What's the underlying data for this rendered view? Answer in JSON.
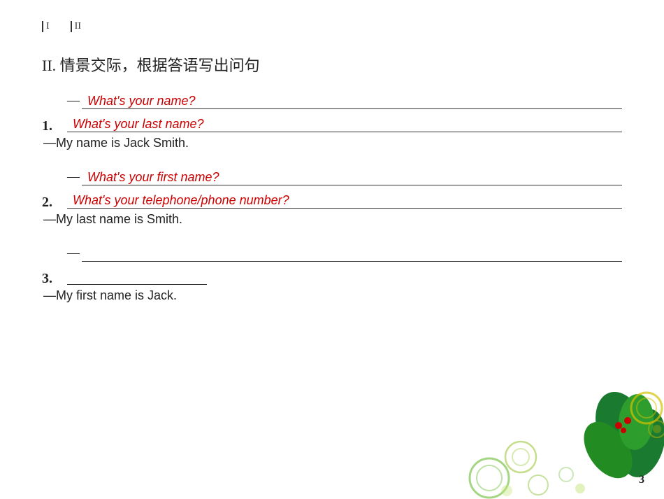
{
  "page": {
    "number": "3",
    "top_markers": [
      "I",
      "II"
    ],
    "section_title": "II. 情景交际，根据答语写出问句",
    "questions": [
      {
        "number": "1.",
        "lines": [
          {
            "prefix": "",
            "answer": "What's your name?"
          },
          {
            "prefix": "",
            "answer": "What's your last name?"
          }
        ],
        "static_answer": "—My name is Jack Smith."
      },
      {
        "number": "2.",
        "lines": [
          {
            "prefix": "",
            "answer": "What's your first name?"
          },
          {
            "prefix": "",
            "answer": "What's your telephone/phone number?"
          }
        ],
        "static_answer": "—My last name is Smith."
      },
      {
        "number": "3.",
        "lines": [
          {
            "prefix": "",
            "answer": ""
          },
          {
            "prefix": "",
            "answer": ""
          }
        ],
        "static_answer": "—My first name is Jack."
      }
    ]
  },
  "decorations": {
    "page_number": "3"
  }
}
